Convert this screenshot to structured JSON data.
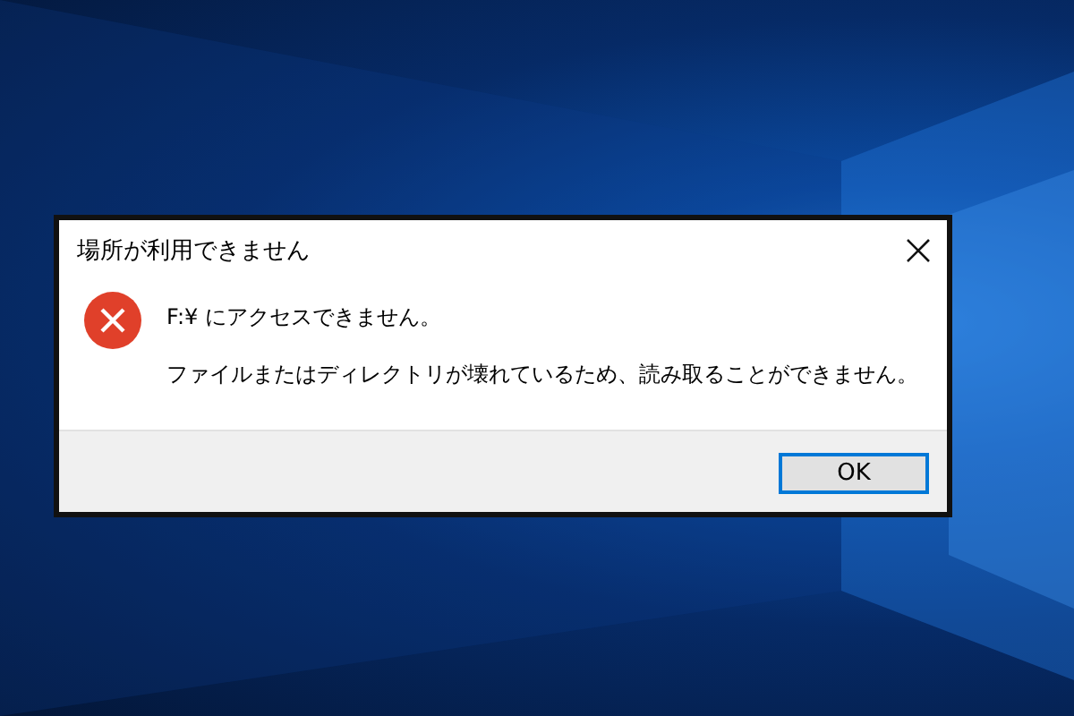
{
  "dialog": {
    "title": "場所が利用できません",
    "heading": "F:¥ にアクセスできません。",
    "message": "ファイルまたはディレクトリが壊れているため、読み取ることができません。",
    "buttons": [
      {
        "label": "OK",
        "selected": true
      }
    ]
  }
}
